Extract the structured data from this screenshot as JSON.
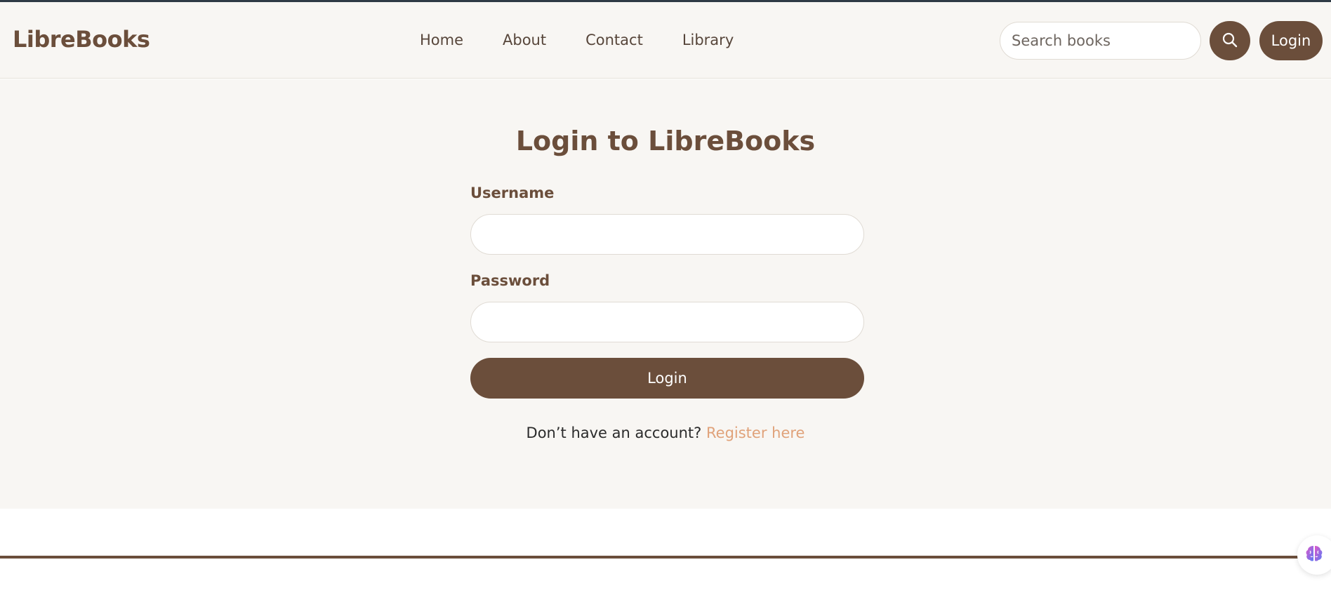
{
  "header": {
    "brand": "LibreBooks",
    "nav": [
      {
        "label": "Home"
      },
      {
        "label": "About"
      },
      {
        "label": "Contact"
      },
      {
        "label": "Library"
      }
    ],
    "search": {
      "placeholder": "Search books",
      "value": "",
      "icon": "search-icon"
    },
    "login_label": "Login"
  },
  "login": {
    "title": "Login to LibreBooks",
    "username_label": "Username",
    "username_value": "",
    "password_label": "Password",
    "password_value": "",
    "submit_label": "Login",
    "register_prompt": "Don’t have an account?",
    "register_link": "Register here"
  },
  "widget": {
    "icon": "brain-icon"
  },
  "colors": {
    "brand": "#6b4e3b",
    "background": "#f8f6f3",
    "link_accent": "#e0a27a"
  }
}
